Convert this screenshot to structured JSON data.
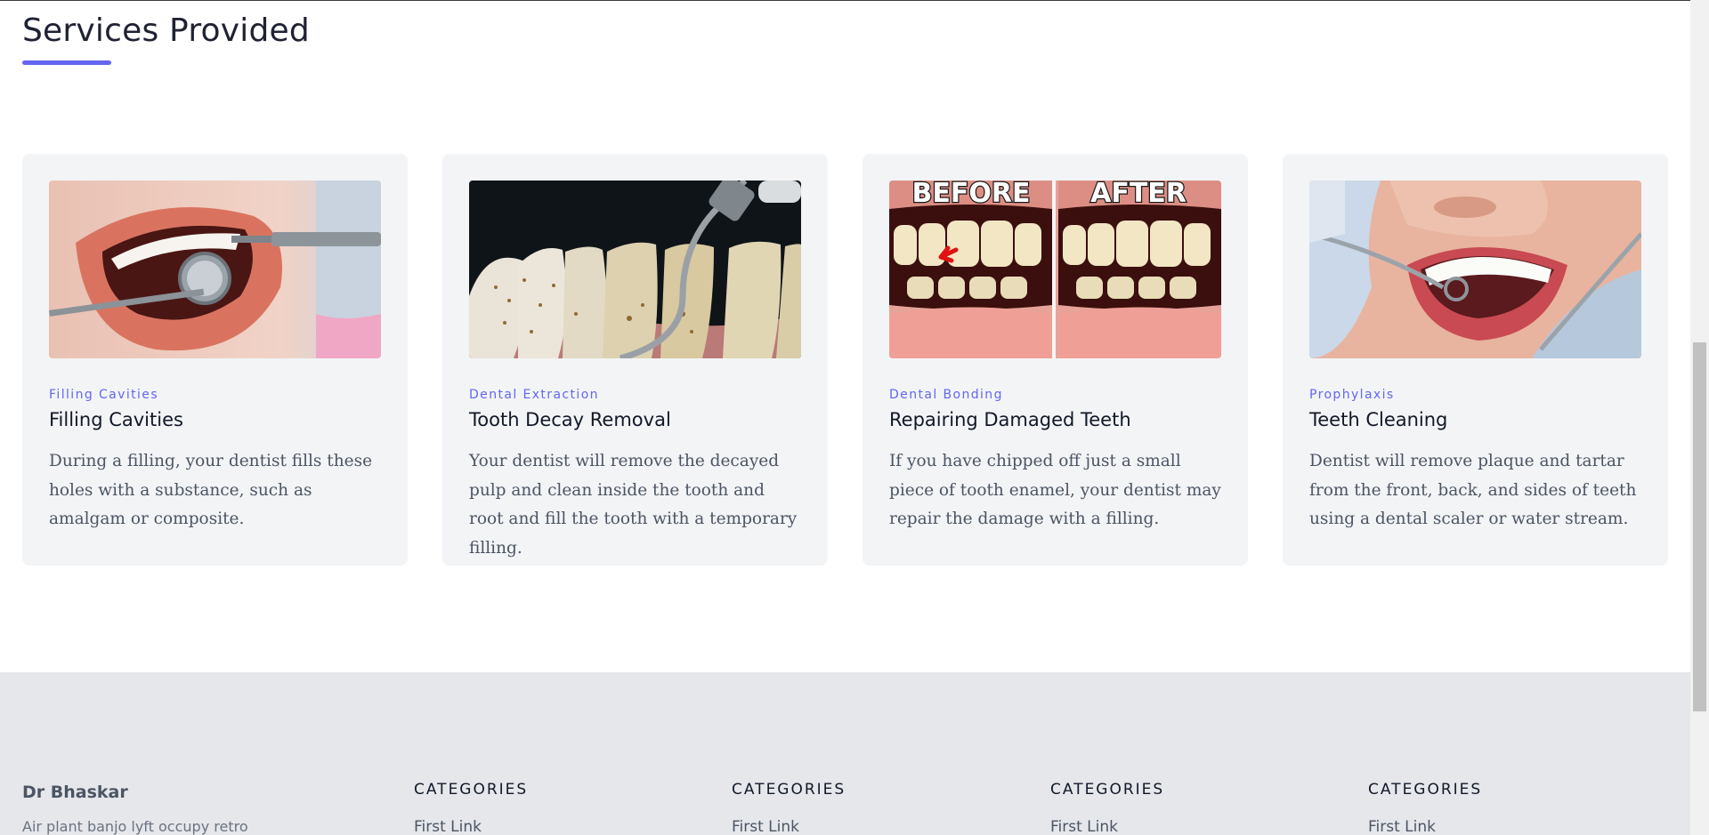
{
  "section": {
    "title": "Services Provided",
    "accent_color": "#6366f1"
  },
  "cards": [
    {
      "tag": "Filling Cavities",
      "title": "Filling Cavities",
      "description": "During a filling, your dentist fills these holes with a substance, such as amalgam or composite.",
      "image": "dental-mirror-smile-photo"
    },
    {
      "tag": "Dental Extraction",
      "title": "Tooth Decay Removal",
      "description": "Your dentist will remove the decayed pulp and clean inside the tooth and root and fill the tooth with a temporary filling.",
      "image": "plaque-scaler-closeup-photo"
    },
    {
      "tag": "Dental Bonding",
      "title": "Repairing Damaged Teeth",
      "description": "If you have chipped off just a small piece of tooth enamel, your dentist may repair the damage with a filling.",
      "image": "before-after-teeth-photo",
      "image_text": {
        "before": "BEFORE",
        "after": "AFTER"
      }
    },
    {
      "tag": "Prophylaxis",
      "title": "Teeth Cleaning",
      "description": "Dentist will remove plaque and tartar from the front, back, and sides of teeth using a dental scaler or water stream.",
      "image": "gloved-dental-cleaning-photo"
    }
  ],
  "footer": {
    "brand": "Dr Bhaskar",
    "description": "Air plant banjo lyft occupy retro",
    "columns": [
      {
        "heading": "CATEGORIES",
        "first_link": "First Link"
      },
      {
        "heading": "CATEGORIES",
        "first_link": "First Link"
      },
      {
        "heading": "CATEGORIES",
        "first_link": "First Link"
      },
      {
        "heading": "CATEGORIES",
        "first_link": "First Link"
      }
    ]
  }
}
